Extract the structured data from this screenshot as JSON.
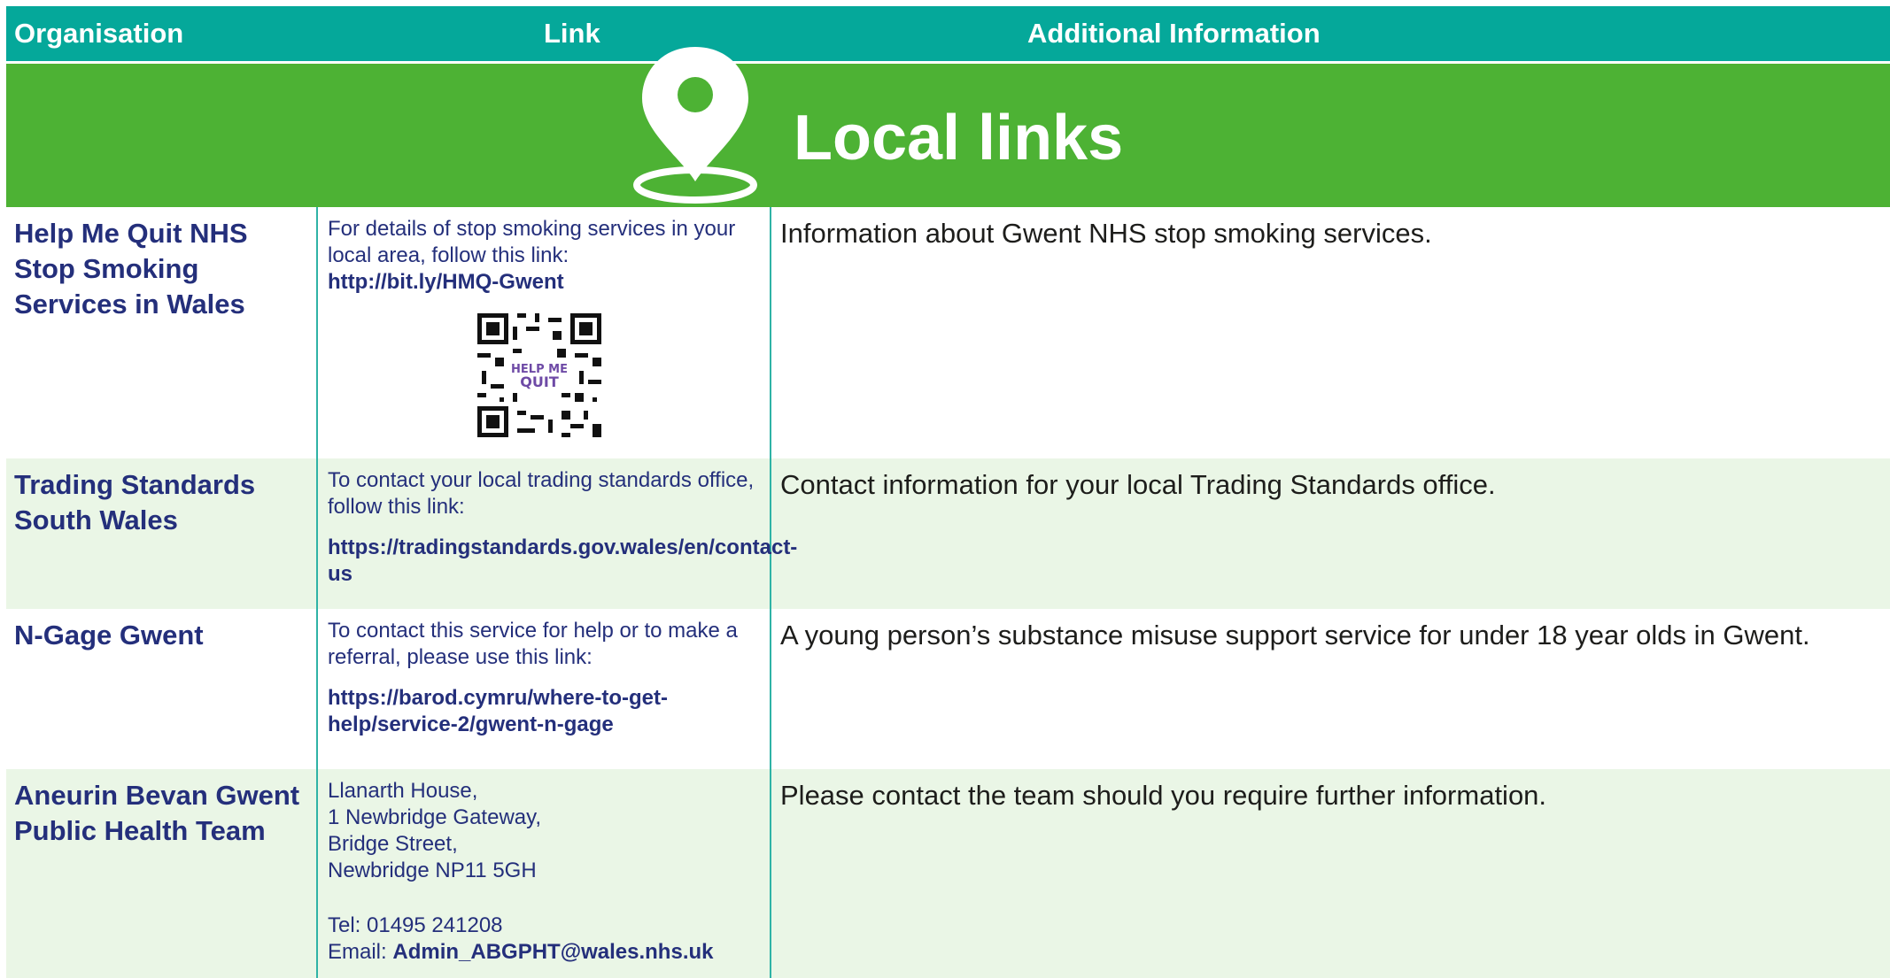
{
  "header": {
    "organisation": "Organisation",
    "link": "Link",
    "additional_information": "Additional Information"
  },
  "banner": {
    "title": "Local links",
    "icon": "location-pin-icon"
  },
  "colors": {
    "header_bg": "#05a89a",
    "banner_bg": "#4db234",
    "row_alt_bg": "#eaf6e6",
    "text_navy": "#242f7b"
  },
  "rows": [
    {
      "organisation": "Help Me Quit NHS Stop Smoking Services in Wales",
      "link_intro": "For details of stop smoking services in your local area, follow this link:",
      "link_url": "http://bit.ly/HMQ-Gwent",
      "qr_label": "HELP ME QUIT",
      "info": "Information about Gwent NHS stop smoking services."
    },
    {
      "organisation": "Trading Standards South Wales",
      "link_intro": "To contact your local trading standards office, follow this link:",
      "link_url": "https://tradingstandards.gov.wales/en/contact-us",
      "info": "Contact information for your local Trading Standards office."
    },
    {
      "organisation": "N-Gage Gwent",
      "link_intro": "To contact this service for help or to make a referral, please use this link:",
      "link_url": "https://barod.cymru/where-to-get-help/service-2/gwent-n-gage",
      "info": "A young person’s substance misuse support service for under 18 year olds in Gwent."
    },
    {
      "organisation": "Aneurin Bevan Gwent Public Health Team",
      "address": [
        "Llanarth House,",
        "1 Newbridge Gateway,",
        "Bridge Street,",
        "Newbridge  NP11 5GH"
      ],
      "tel": "Tel: 01495 241208",
      "email_label": "Email:",
      "email": "Admin_ABGPHT@wales.nhs.uk",
      "info": "Please contact the team should you require further information."
    }
  ]
}
